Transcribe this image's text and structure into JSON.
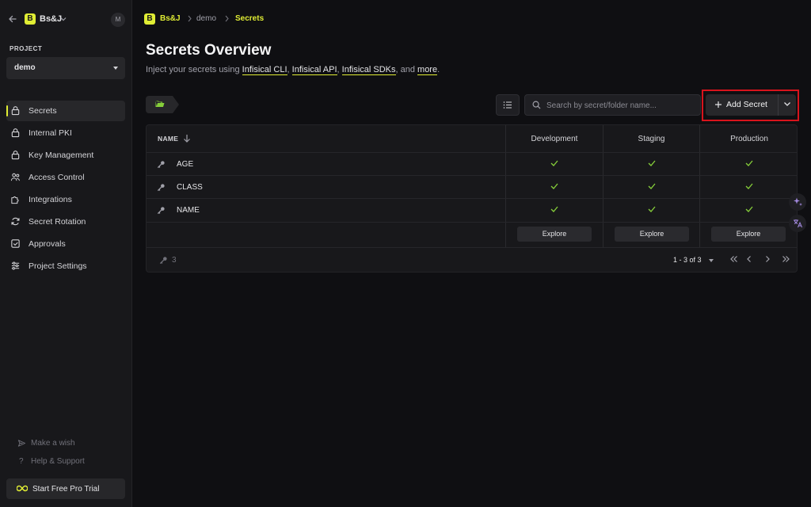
{
  "org": {
    "initial": "B",
    "name": "Bs&J",
    "avatar": "M"
  },
  "project": {
    "section_label": "PROJECT",
    "selected": "demo"
  },
  "nav": [
    {
      "label": "Secrets",
      "icon": "lock-icon",
      "active": true
    },
    {
      "label": "Internal PKI",
      "icon": "lock-icon"
    },
    {
      "label": "Key Management",
      "icon": "lock-icon"
    },
    {
      "label": "Access Control",
      "icon": "users-icon"
    },
    {
      "label": "Integrations",
      "icon": "puzzle-icon"
    },
    {
      "label": "Secret Rotation",
      "icon": "rotate-icon"
    },
    {
      "label": "Approvals",
      "icon": "checkbox-icon"
    },
    {
      "label": "Project Settings",
      "icon": "sliders-icon"
    }
  ],
  "footer_links": {
    "wish": "Make a wish",
    "help": "Help & Support",
    "trial": "Start Free Pro Trial"
  },
  "breadcrumb": {
    "org": "Bs&J",
    "project": "demo",
    "page": "Secrets"
  },
  "page": {
    "title": "Secrets Overview",
    "subtitle_prefix": "Inject your secrets using ",
    "link_cli": "Infisical CLI",
    "sep1": ", ",
    "link_api": "Infisical API",
    "sep2": ", ",
    "link_sdks": "Infisical SDKs",
    "sep3": ", and ",
    "link_more": "more",
    "subtitle_suffix": "."
  },
  "toolbar": {
    "search_placeholder": "Search by secret/folder name...",
    "add_label": "Add Secret"
  },
  "table": {
    "name_header": "NAME",
    "environments": [
      "Development",
      "Staging",
      "Production"
    ],
    "rows": [
      {
        "name": "AGE",
        "present": [
          true,
          true,
          true
        ]
      },
      {
        "name": "CLASS",
        "present": [
          true,
          true,
          true
        ]
      },
      {
        "name": "NAME",
        "present": [
          true,
          true,
          true
        ]
      }
    ],
    "explore_label": "Explore",
    "count": "3",
    "range": "1 - 3 of 3"
  }
}
